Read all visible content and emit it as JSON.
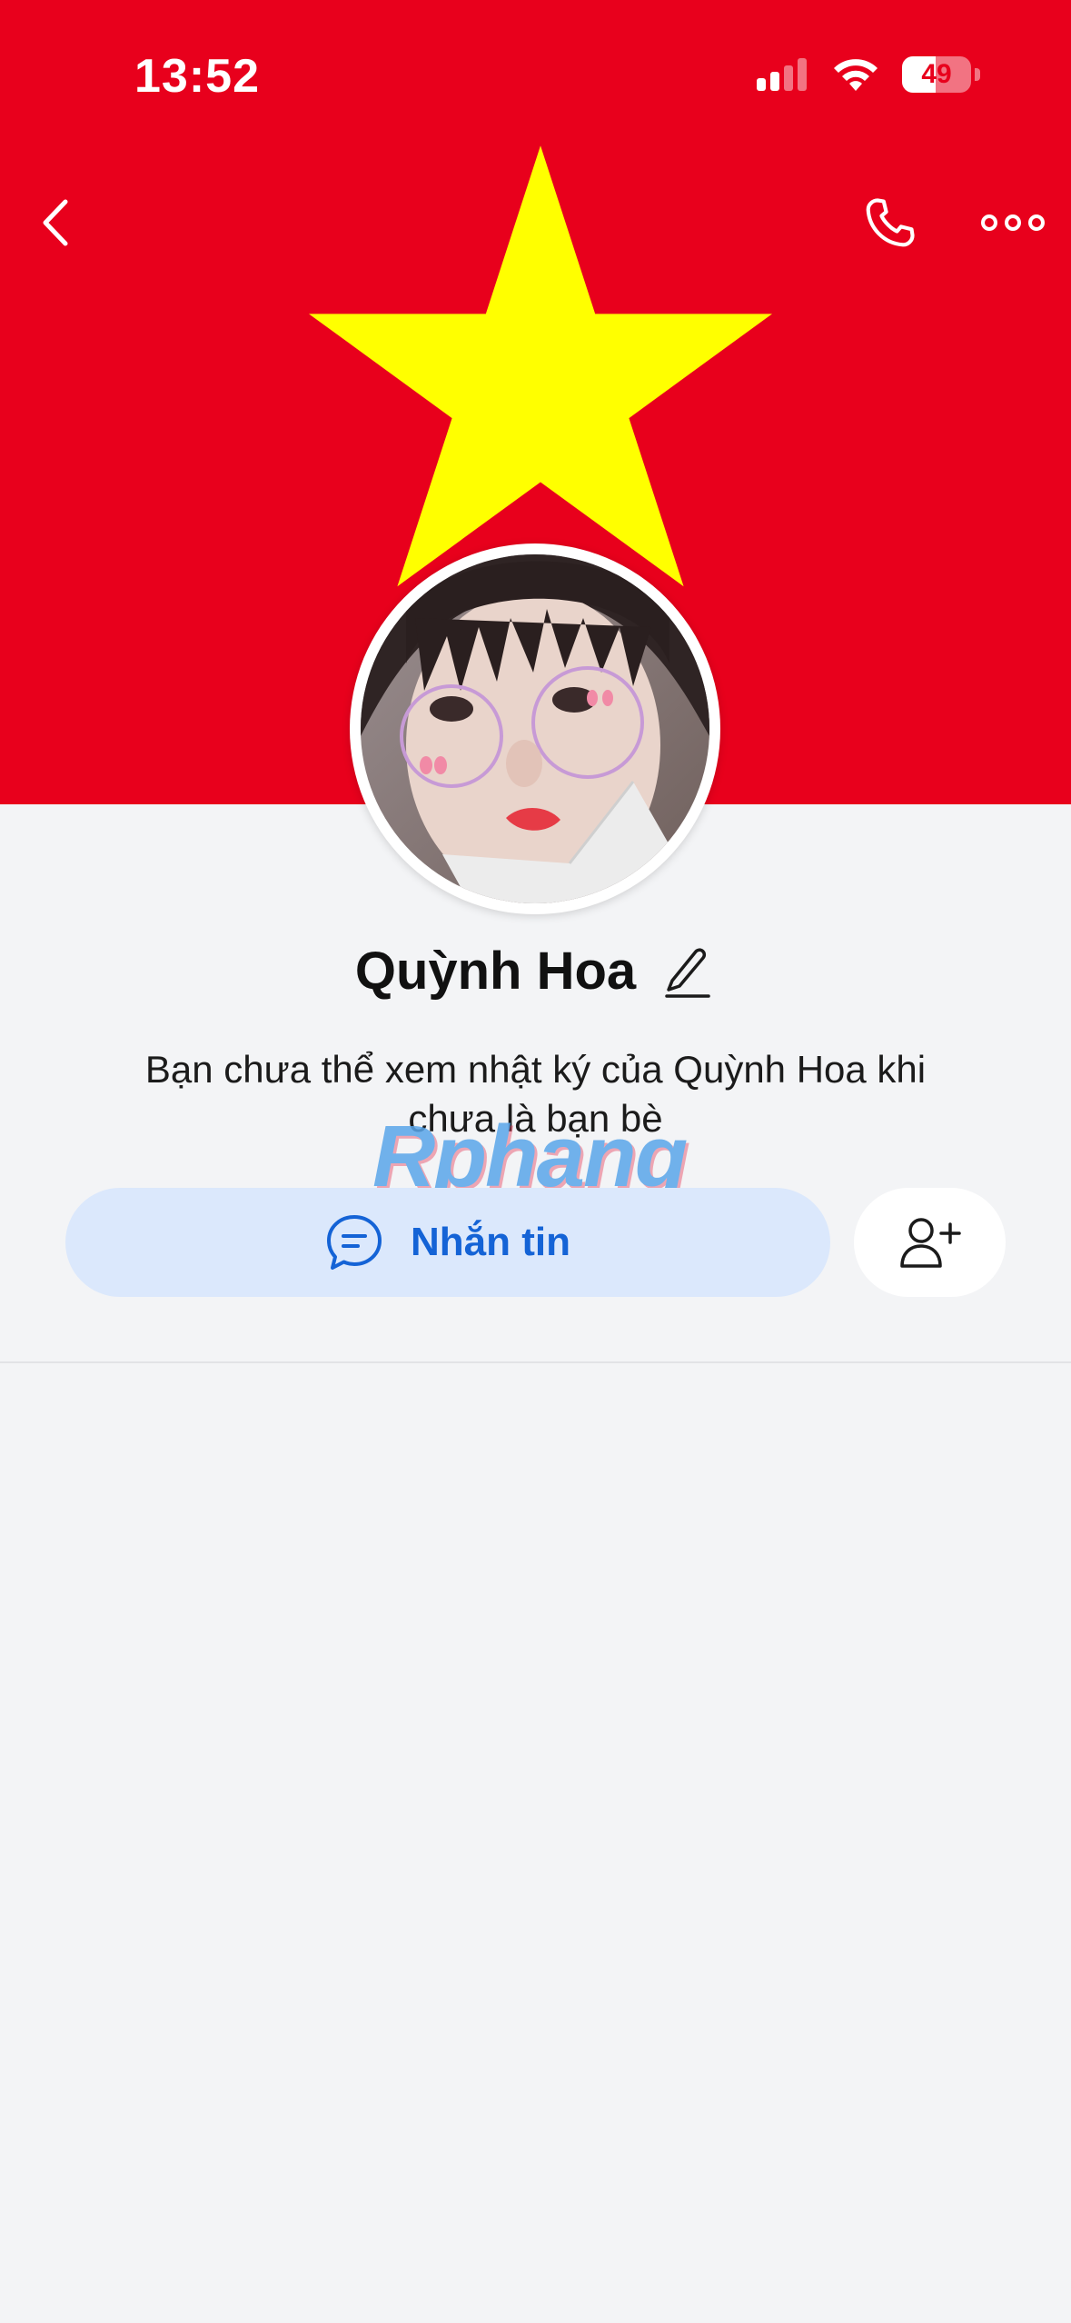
{
  "status_bar": {
    "time": "13:52",
    "battery_level": "49",
    "icons": [
      "cellular-signal-icon",
      "wifi-icon",
      "battery-icon"
    ]
  },
  "nav": {
    "back_icon": "chevron-left-icon",
    "call_icon": "phone-icon",
    "more_icon": "ellipsis-icon"
  },
  "cover": {
    "background_color": "#e8001c",
    "star_color": "#ffff00"
  },
  "profile": {
    "name": "Quỳnh Hoa",
    "edit_icon": "pencil-icon",
    "notice": "Bạn chưa thể xem nhật ký của Quỳnh Hoa khi chưa là bạn bè"
  },
  "watermark": "Rphang",
  "actions": {
    "message_label": "Nhắn tin",
    "message_icon": "chat-bubble-icon",
    "add_friend_icon": "add-friend-icon"
  },
  "colors": {
    "accent": "#1463d6",
    "button_bg": "#dbe8fc",
    "page_bg": "#f3f4f6"
  }
}
